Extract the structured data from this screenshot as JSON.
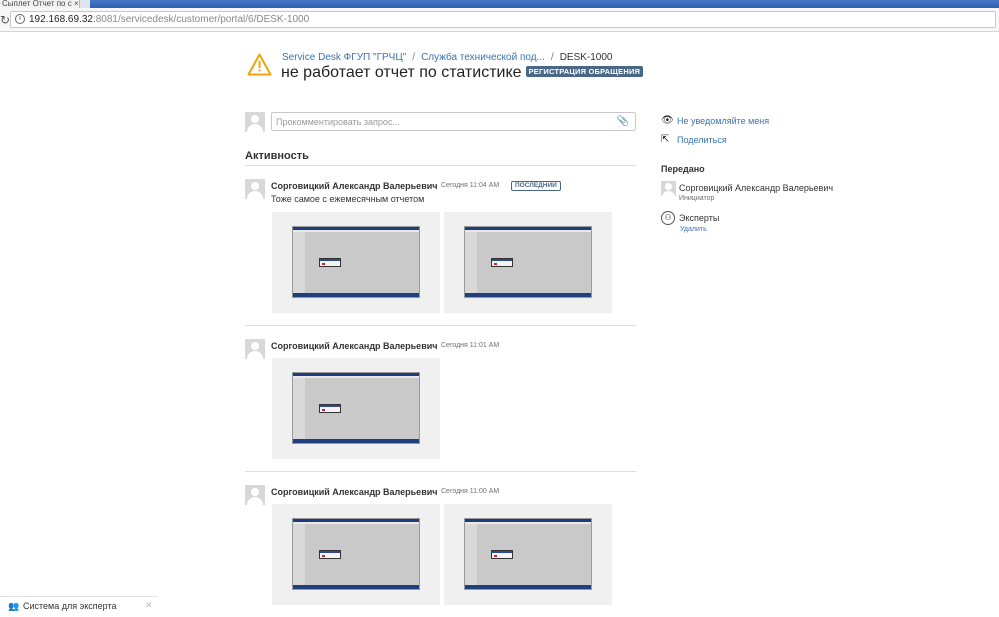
{
  "browser": {
    "tab_title": "Сыплет Отчет по с",
    "url_host": "192.168.69.32",
    "url_path": ":8081/servicedesk/customer/portal/6/DESK-1000"
  },
  "header": {
    "breadcrumb": [
      "Service Desk ФГУП \"ГРЧЦ\"",
      "Служба технической под...",
      "DESK-1000"
    ],
    "title": "не работает отчет по статистике",
    "status": "РЕГИСТРАЦИЯ ОБРАЩЕНИЯ"
  },
  "comment_box": {
    "placeholder": "Прокомментировать запрос..."
  },
  "activity": {
    "heading": "Активность",
    "entries": [
      {
        "author": "Сорговицкий Александр Валерьевич",
        "time": "Сегодня 11:04 AM",
        "badge": "ПОСЛЕДНИЙ",
        "text": "Тоже самое с ежемесячным отчетом",
        "attachments": 2
      },
      {
        "author": "Сорговицкий Александр Валерьевич",
        "time": "Сегодня 11:01 AM",
        "attachments": 1
      },
      {
        "author": "Сорговицкий Александр Валерьевич",
        "time": "Сегодня 11:00 AM",
        "attachments": 2
      }
    ]
  },
  "sidebar": {
    "notify_link": "Не уведомляйте меня",
    "share_link": "Поделиться",
    "shared_heading": "Передано",
    "person": {
      "name": "Сорговицкий Александр Валерьевич",
      "role": "Инициатор"
    },
    "group": {
      "name": "Эксперты",
      "remove": "Удалить"
    }
  },
  "download_bar": {
    "label": "Система для эксперта"
  },
  "colors": {
    "link": "#3b73af",
    "lozenge": "#4a6785",
    "warning": "#f0a30a"
  }
}
